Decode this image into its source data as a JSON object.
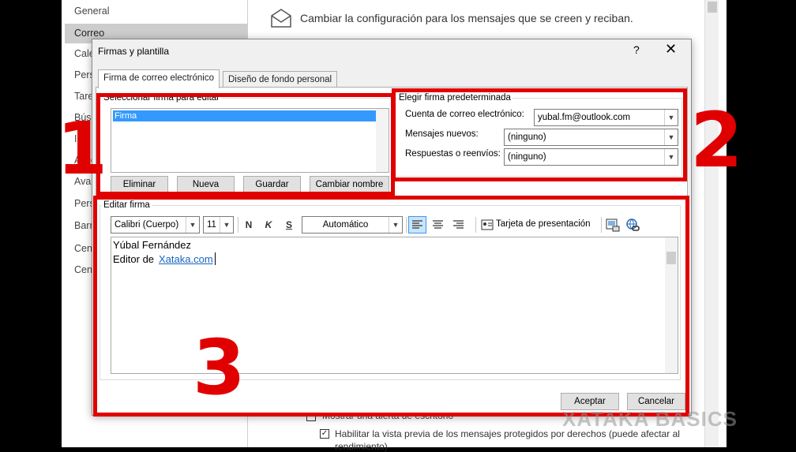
{
  "background_window": {
    "header_text": "Cambiar la configuración para los mensajes que se creen y reciban.",
    "sidebar": [
      {
        "label": "General",
        "active": false
      },
      {
        "label": "Correo",
        "active": true
      },
      {
        "label": "Cale",
        "active": false
      },
      {
        "label": "Pers",
        "active": false
      },
      {
        "label": "Tare",
        "active": false
      },
      {
        "label": "Búsq",
        "active": false
      },
      {
        "label": "Idio",
        "active": false
      },
      {
        "label": "Acce",
        "active": false
      },
      {
        "label": "Avan",
        "active": false
      },
      {
        "label": "Pers",
        "active": false
      },
      {
        "label": "Barr",
        "active": false
      },
      {
        "label": "Cent",
        "active": false
      },
      {
        "label": "Cent",
        "active": false
      }
    ],
    "checkbox_row_1": "Mostrar una alerta de escritorio",
    "checkbox_row_2": "Habilitar la vista previa de los mensajes protegidos por derechos (puede afectar al",
    "checkbox_row_2b": "rendimiento)"
  },
  "dialog": {
    "title": "Firmas y plantilla",
    "help": "?",
    "close": "✕",
    "tabs": [
      "Firma de correo electrónico",
      "Diseño de fondo personal"
    ],
    "select_group_label": "Seleccionar firma para editar",
    "signatures": [
      "Firma"
    ],
    "buttons": {
      "delete": "Eliminar",
      "new": "Nueva",
      "save": "Guardar",
      "rename": "Cambiar nombre"
    },
    "default_group_label": "Elegir firma predeterminada",
    "account_label": "Cuenta de correo electrónico:",
    "account_value": "yubal.fm@outlook.com",
    "new_messages_label": "Mensajes nuevos:",
    "new_messages_value": "(ninguno)",
    "replies_label": "Respuestas o reenvíos:",
    "replies_value": "(ninguno)",
    "edit_group_label": "Editar firma",
    "toolbar": {
      "font": "Calibri (Cuerpo)",
      "size": "11",
      "bold": "N",
      "italic": "K",
      "underline": "S",
      "color": "Automático",
      "business_card": "Tarjeta de presentación"
    },
    "editor_line1": "Yúbal Fernández",
    "editor_line2_prefix": "Editor de ",
    "editor_link": "Xataka.com",
    "ok": "Aceptar",
    "cancel": "Cancelar"
  },
  "annotations": {
    "n1": "1",
    "n2": "2",
    "n3": "3"
  },
  "watermark": "XATAKA BASICS",
  "colors": {
    "annotation_red": "#e00000",
    "selection_blue": "#3399ff",
    "link_blue": "#1565c0"
  }
}
